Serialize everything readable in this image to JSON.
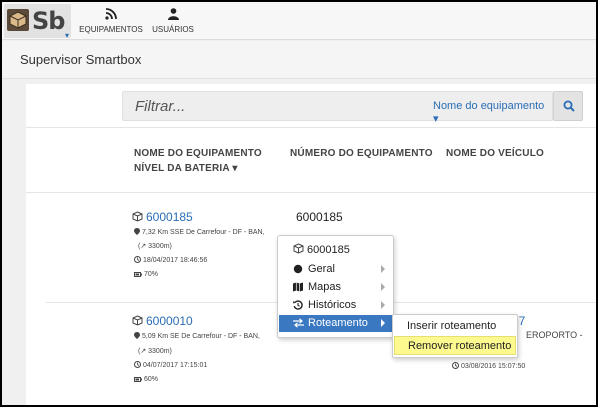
{
  "brand": {
    "logo_text": "Sb",
    "caret": "▾"
  },
  "nav": {
    "equipamentos": "EQUIPAMENTOS",
    "usuarios": "USUÁRIOS"
  },
  "title": "Supervisor Smartbox",
  "search": {
    "placeholder": "Filtrar...",
    "filter_label": "Nome do equipamento ▾"
  },
  "columns": {
    "nome_line1": "NOME DO EQUIPAMENTO",
    "nome_line2": "NÍVEL DA BATERIA ▾",
    "numero": "NÚMERO DO EQUIPAMENTO",
    "veiculo": "NOME DO VEÍCULO"
  },
  "rows": [
    {
      "name": "6000185",
      "location": "7,32 Km SSE De Carrefour - DF - BAN,",
      "distance": "(↗ 3300m)",
      "datetime": "18/04/2017 18:46:56",
      "battery": "70%",
      "number": "6000185"
    },
    {
      "name": "6000010",
      "location": "5,09 Km SE De Carrefour - DF - BAN,",
      "distance": "(↗ 3300m)",
      "datetime": "04/07/2017 17:15:01",
      "battery": "60%",
      "number_partial": "57",
      "vehicle_partial": "EROPORTO -",
      "vehicle_datetime": "03/08/2016 15:07:50"
    }
  ],
  "context_menu": {
    "header": "6000185",
    "items": [
      {
        "label": "Geral"
      },
      {
        "label": "Mapas"
      },
      {
        "label": "Históricos"
      },
      {
        "label": "Roteamento"
      }
    ],
    "submenu": [
      "Inserir roteamento",
      "Remover roteamento"
    ]
  },
  "colors": {
    "accent": "#2a6db5",
    "active": "#3a78c2",
    "highlight": "#fcfa8f"
  }
}
